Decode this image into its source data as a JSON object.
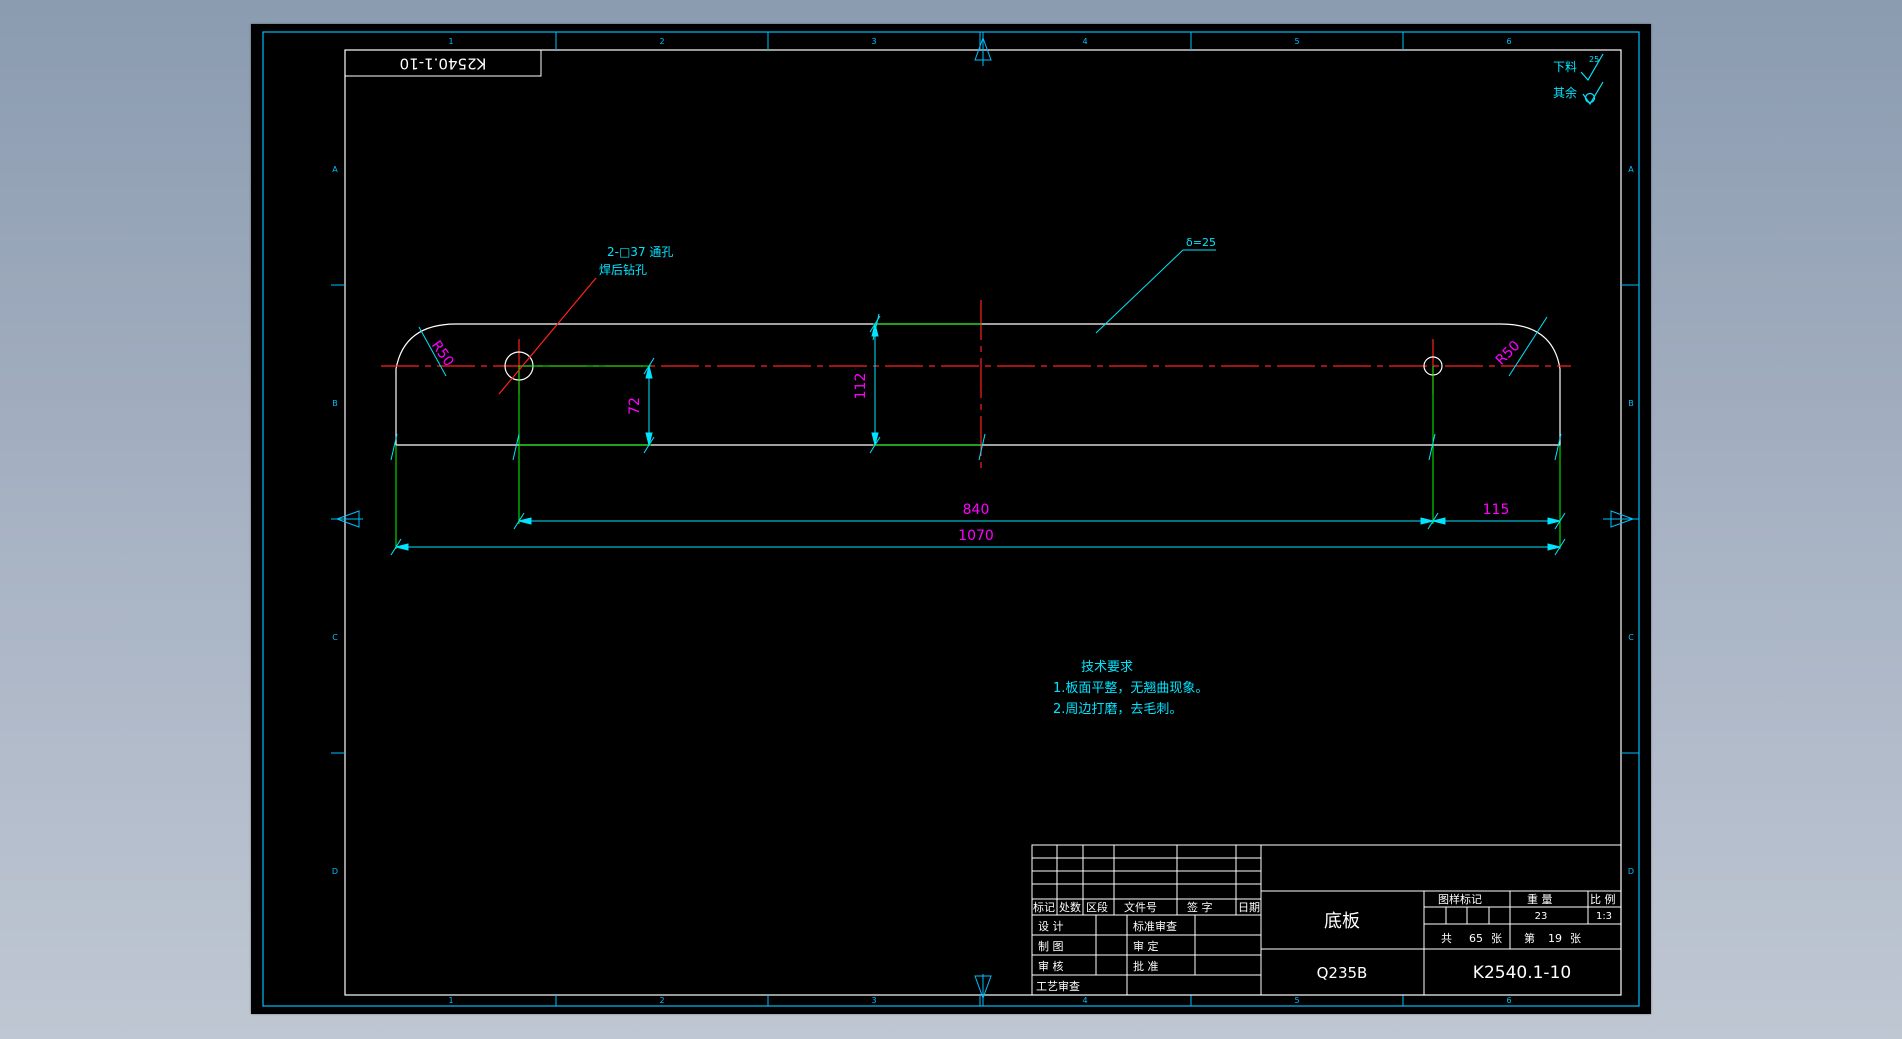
{
  "colors": {
    "background": "#000000",
    "border": "#00bfff",
    "outline": "#ffffff",
    "dimension": "#00e5ff",
    "extension": "#00ff00",
    "centerline": "#ff2020",
    "dimension_text": "#ff00ff",
    "note_text": "#00e5ff",
    "titleblock_text": "#ffffff"
  },
  "drawing_number_box": "K2540.1-10",
  "surface_finish": {
    "blank_label": "下料",
    "blank_value": "25",
    "other_label": "其余"
  },
  "annotations": {
    "hole_callout_line1": "2-□37 通孔",
    "hole_callout_line2": "焊后钻孔",
    "thickness": "δ=25",
    "corner_radius_left": "R50",
    "corner_radius_right": "R50"
  },
  "dimensions": {
    "overall_length": "1070",
    "hole_spacing": "840",
    "hole_to_edge": "115",
    "plate_width": "112",
    "hole_offset": "72"
  },
  "tech_requirements": {
    "title": "技术要求",
    "items": [
      "1.板面平整，无翘曲现象。",
      "2.周边打磨，去毛刺。"
    ]
  },
  "border_zones": {
    "top": [
      "1",
      "2",
      "3",
      "4",
      "5",
      "6"
    ],
    "side": [
      "A",
      "B",
      "C",
      "D"
    ]
  },
  "title_block": {
    "header_cells": [
      "标记",
      "处数",
      "区段",
      "文件号",
      "签 字",
      "日期"
    ],
    "left_rows": [
      {
        "role": "设 计",
        "review": "标准审查"
      },
      {
        "role": "制 图",
        "review": "审 定"
      },
      {
        "role": "审 核",
        "review": "批 准"
      },
      {
        "role": "工艺审查",
        "review": ""
      }
    ],
    "part_name": "底板",
    "material": "Q235B",
    "drawing_number": "K2540.1-10",
    "labels": {
      "graphic_mark": "图样标记",
      "weight": "重 量",
      "scale": "比 例",
      "total_prefix": "共",
      "total_suffix": "张",
      "sheet_prefix": "第",
      "sheet_suffix": "张"
    },
    "weight_value": "23",
    "scale_value": "1:3",
    "total_sheets": "65",
    "sheet_number": "19"
  }
}
